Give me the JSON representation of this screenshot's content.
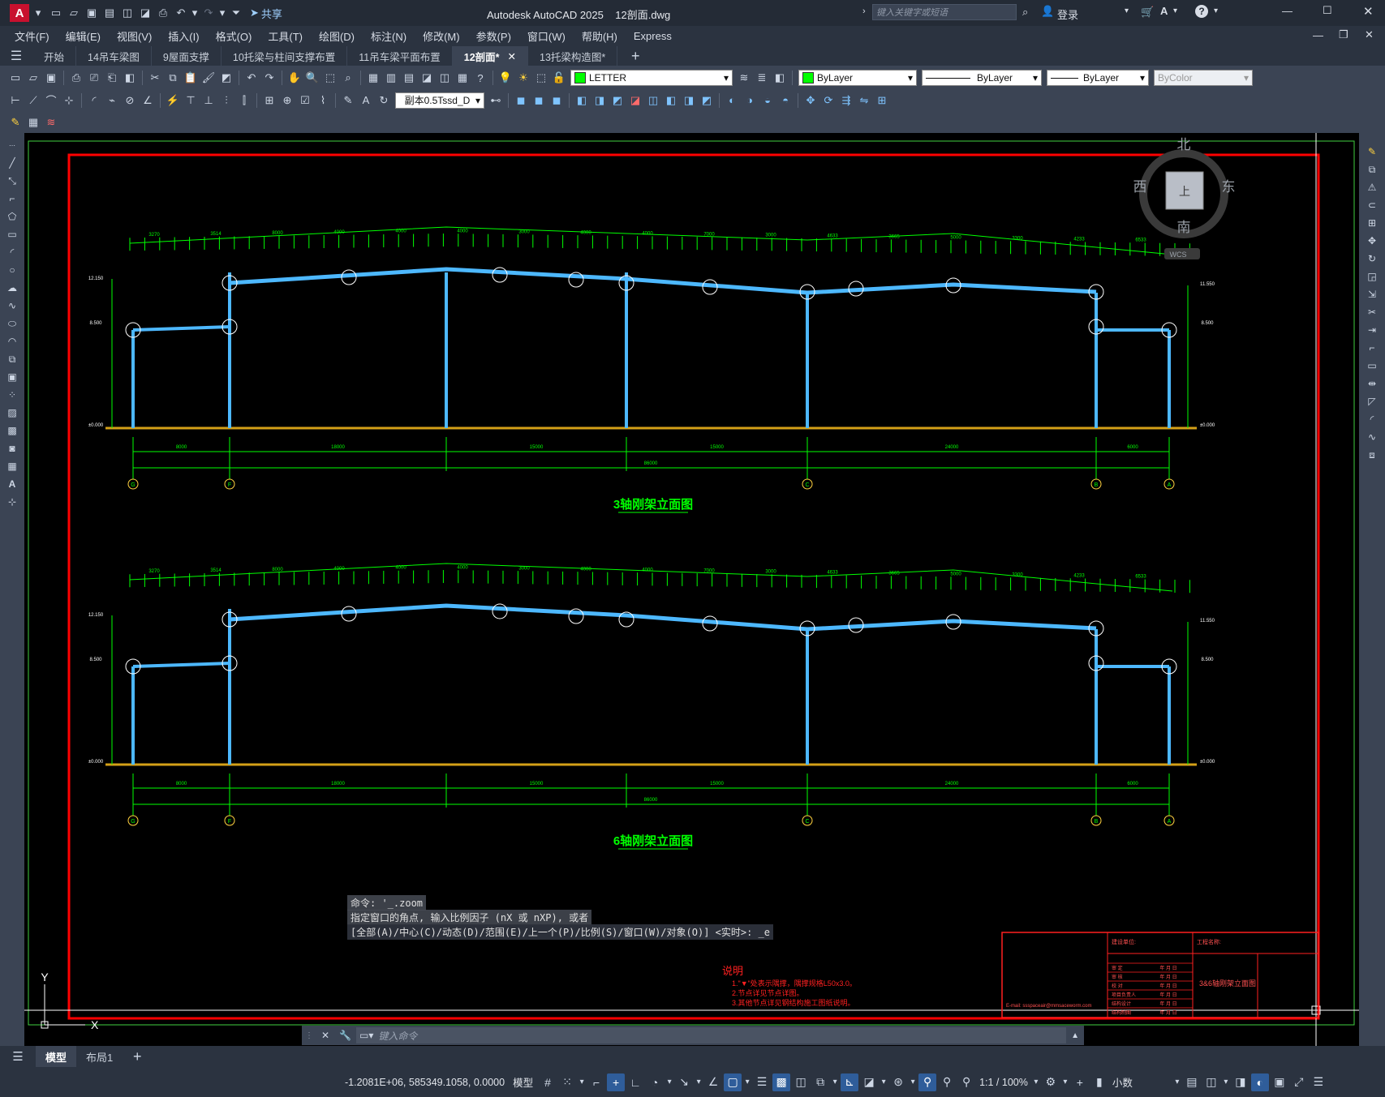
{
  "titlebar": {
    "app_badge": "A",
    "share_label": "共享",
    "title": "Autodesk AutoCAD 2025    12剖面.dwg",
    "search_placeholder": "键入关键字或短语",
    "login_label": "登录"
  },
  "menu": [
    "文件(F)",
    "编辑(E)",
    "视图(V)",
    "插入(I)",
    "格式(O)",
    "工具(T)",
    "绘图(D)",
    "标注(N)",
    "修改(M)",
    "参数(P)",
    "窗口(W)",
    "帮助(H)",
    "Express"
  ],
  "tabs": [
    {
      "label": "开始",
      "active": false
    },
    {
      "label": "14吊车梁图",
      "active": false
    },
    {
      "label": "9屋面支撑",
      "active": false
    },
    {
      "label": "10托梁与柱间支撑布置",
      "active": false
    },
    {
      "label": "11吊车梁平面布置",
      "active": false
    },
    {
      "label": "12剖面*",
      "active": true
    },
    {
      "label": "13托梁构造图*",
      "active": false
    }
  ],
  "toolbar": {
    "layer_name": "LETTER",
    "color": "ByLayer",
    "linetype": "ByLayer",
    "lineweight": "ByLayer",
    "plotstyle": "ByColor",
    "dimstyle": "副本0.5Tssd_D"
  },
  "viewcube": {
    "north": "北",
    "south": "南",
    "east": "东",
    "west": "西",
    "top": "上",
    "wcs": "WCS"
  },
  "drawing": {
    "title1": "3轴刚架立面图",
    "title2": "6轴刚架立面图",
    "bottom_dims": [
      "8000",
      "18000",
      "15000",
      "15000",
      "24000",
      "6000"
    ],
    "total_dim": "86000",
    "axes": [
      "G",
      "F",
      "C",
      "B",
      "A"
    ],
    "top_dims_row1": [
      "3270",
      "3514",
      "8000",
      "4000",
      "4000",
      "4000",
      "3000",
      "4000",
      "4000",
      "7000",
      "3000",
      "4633",
      "3665",
      "5000",
      "3300",
      "4233",
      "6533"
    ],
    "elev_left": [
      "12.150",
      "8.500",
      "±0.000"
    ],
    "elev_right": [
      "11.550",
      "8.500",
      "±0.000"
    ],
    "notes_title": "说明",
    "notes": [
      "1.\"▼\"处表示隅撑，隅撑规格L50x3.0。",
      "2.节点详见节点详图。",
      "3.其他节点详见钢结构施工图纸说明。"
    ],
    "title_block": {
      "build_unit": "建设单位:",
      "project": "工程名称:",
      "drawing_name": "3&6轴刚架立面图",
      "email": "E-mail: ssspaceair@mmsaceworm.com",
      "rows": [
        "审  定",
        "审  核",
        "校  对",
        "项目负责人",
        "结构设计",
        "结构制图"
      ],
      "date_label": "年 月 日"
    }
  },
  "ucs": {
    "x": "X",
    "y": "Y"
  },
  "command": {
    "line1": "命令: '_.zoom",
    "line2": "指定窗口的角点, 输入比例因子 (nX 或 nXP), 或者",
    "line3": "[全部(A)/中心(C)/动态(D)/范围(E)/上一个(P)/比例(S)/窗口(W)/对象(O)] <实时>: _e",
    "placeholder": "键入命令"
  },
  "layout_tabs": [
    {
      "label": "模型",
      "active": true
    },
    {
      "label": "布局1",
      "active": false
    }
  ],
  "status": {
    "coords": "-1.2081E+06, 585349.1058, 0.0000",
    "mode": "模型",
    "scale": "1:1 / 100%",
    "units": "小数"
  },
  "colors": {
    "frame": "#4db8ff",
    "dim": "#00ff00",
    "border": "#ff0000",
    "ground": "#d4a017",
    "notes": "#ff2020"
  }
}
